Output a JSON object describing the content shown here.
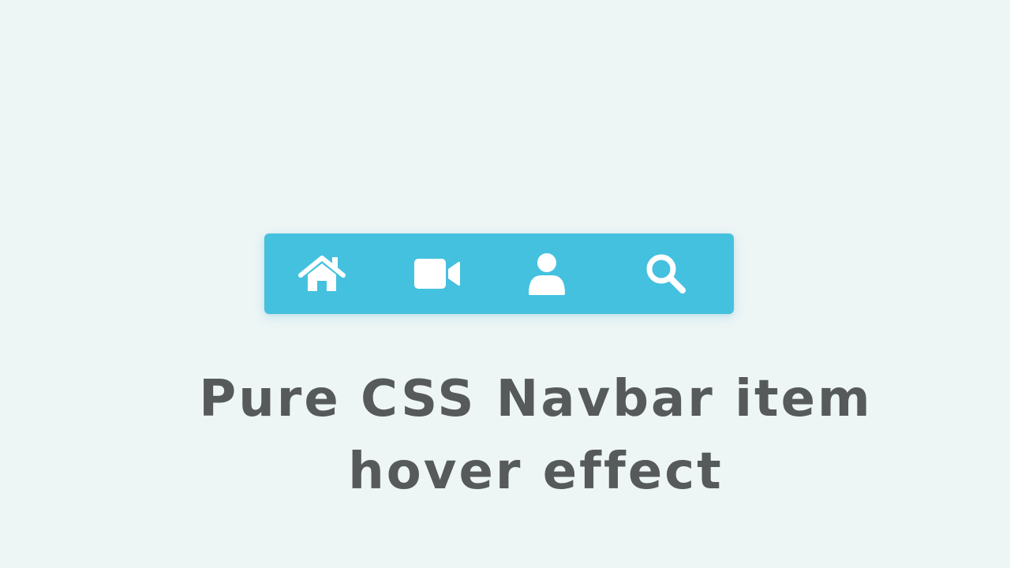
{
  "colors": {
    "background": "#eef5f5",
    "navbar": "#44c1df",
    "icon": "#ffffff",
    "title_text": "#575a5a"
  },
  "navbar": {
    "items": [
      {
        "icon": "home-icon"
      },
      {
        "icon": "video-camera-icon"
      },
      {
        "icon": "user-icon"
      },
      {
        "icon": "search-icon"
      }
    ]
  },
  "heading": {
    "line1": "Pure CSS Navbar item",
    "line2": "hover effect"
  }
}
